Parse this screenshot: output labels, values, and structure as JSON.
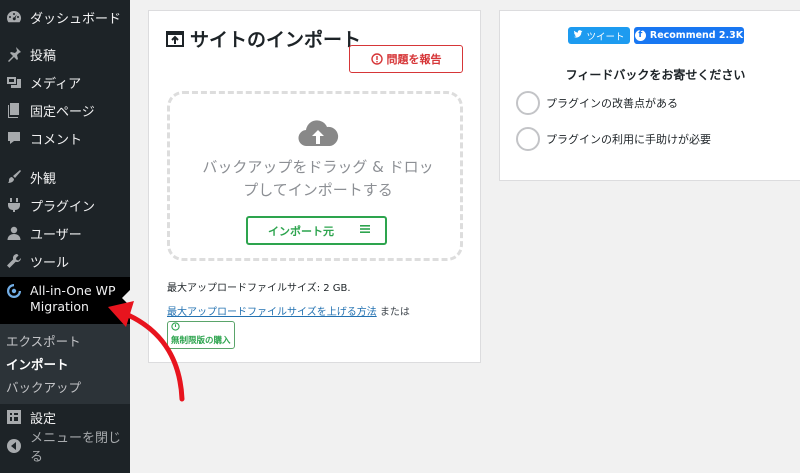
{
  "sidebar": {
    "dashboard": "ダッシュボード",
    "posts": "投稿",
    "media": "メディア",
    "pages": "固定ページ",
    "comments": "コメント",
    "appearance": "外観",
    "plugins": "プラグイン",
    "users": "ユーザー",
    "tools": "ツール",
    "aiowm_line1": "All-in-One WP",
    "aiowm_line2": "Migration",
    "sub": {
      "export": "エクスポート",
      "import": "インポート",
      "backup": "バックアップ"
    },
    "settings": "設定",
    "collapse": "メニューを閉じる"
  },
  "import_panel": {
    "title": "サイトのインポート",
    "report_button": "問題を報告",
    "drop_line1": "バックアップをドラッグ & ドロッ",
    "drop_line2": "プしてインポートする",
    "import_from_button": "インポート元",
    "max_upload": "最大アップロードファイルサイズ: 2 GB.",
    "increase_link": "最大アップロードファイルサイズを上げる方法",
    "or_text": " または ",
    "unlimited_badge": "無制限版の購入"
  },
  "feedback_panel": {
    "tweet_button": "ツイート",
    "recommend_button": "Recommend 2.3K",
    "title": "フィードバックをお寄せください",
    "option_improve": "プラグインの改善点がある",
    "option_help": "プラグインの利用に手助けが必要"
  },
  "colors": {
    "sidebar_bg": "#1d2327",
    "accent_blue": "#2271b1",
    "report_red": "#d63638",
    "import_green": "#2da44e",
    "arrow_red": "#e8141e"
  }
}
